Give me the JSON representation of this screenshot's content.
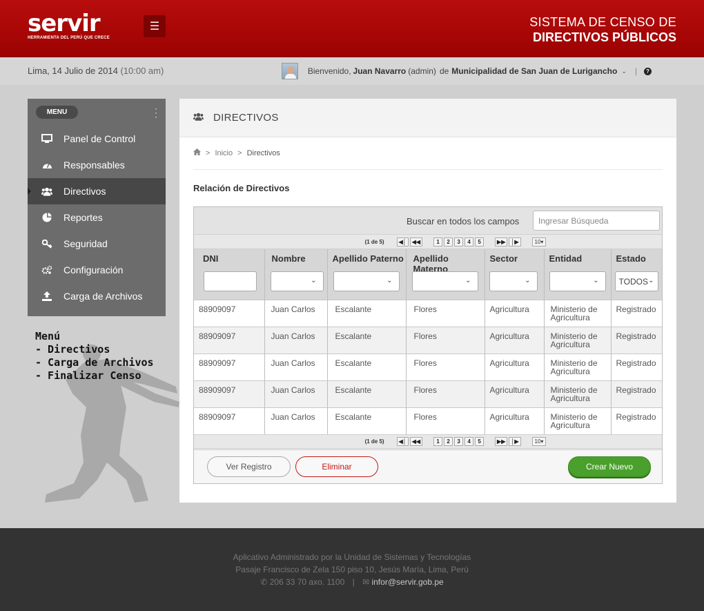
{
  "header": {
    "logo_text": "servir",
    "logo_sub": "HERRAMIENTA DEL PERÚ QUE CRECE",
    "title_line1": "SISTEMA DE CENSO  DE",
    "title_line2": "DIRECTIVOS PÚBLICOS"
  },
  "subheader": {
    "date": "Lima, 14 Julio de 2014",
    "time": "(10:00 am)",
    "welcome": "Bienvenido,",
    "user_name": "Juan Navarro",
    "role": "(admin)",
    "de": "de",
    "municipality": "Municipalidad de San Juan de Lurigancho",
    "separator": "|"
  },
  "sidebar": {
    "menu_label": "MENU",
    "items": [
      {
        "label": "Panel de Control",
        "icon": "monitor-icon",
        "active": false
      },
      {
        "label": "Responsables",
        "icon": "dashboard-icon",
        "active": false
      },
      {
        "label": "Directivos",
        "icon": "users-icon",
        "active": true
      },
      {
        "label": "Reportes",
        "icon": "pie-chart-icon",
        "active": false
      },
      {
        "label": "Seguridad",
        "icon": "key-icon",
        "active": false
      },
      {
        "label": "Configuración",
        "icon": "gears-icon",
        "active": false
      },
      {
        "label": "Carga de Archivos",
        "icon": "upload-icon",
        "active": false
      }
    ]
  },
  "menu_note": {
    "line1": "Menú",
    "line2": "- Directivos",
    "line3": "- Carga de Archivos",
    "line4": "- Finalizar Censo"
  },
  "panel": {
    "title": "DIRECTIVOS",
    "breadcrumb": {
      "home": "Inicio",
      "current": "Directivos"
    },
    "section_title": "Relación de Directivos",
    "search_label": "Buscar en todos los campos",
    "search_placeholder": "Ingresar Búsqueda",
    "pager": {
      "info": "(1 de 5)",
      "first": "⏮",
      "prev": "⏪",
      "pages": [
        "1",
        "2",
        "3",
        "4",
        "5"
      ],
      "next": "⏩",
      "last": "⏭",
      "per_page": "10▾"
    },
    "columns": [
      "DNI",
      "Nombre",
      "Apellido Paterno",
      "Apellido Materno",
      "Sector",
      "Entidad",
      "Estado"
    ],
    "estado_filter": "TODOS",
    "rows": [
      {
        "dni": "88909097",
        "nombre": "Juan Carlos",
        "paterno": "Escalante",
        "materno": "Flores",
        "sector": "Agricultura",
        "entidad": "Ministerio de Agricultura",
        "estado": "Registrado"
      },
      {
        "dni": "88909097",
        "nombre": "Juan Carlos",
        "paterno": "Escalante",
        "materno": "Flores",
        "sector": "Agricultura",
        "entidad": "Ministerio de Agricultura",
        "estado": "Registrado"
      },
      {
        "dni": "88909097",
        "nombre": "Juan Carlos",
        "paterno": "Escalante",
        "materno": "Flores",
        "sector": "Agricultura",
        "entidad": "Ministerio de Agricultura",
        "estado": "Registrado"
      },
      {
        "dni": "88909097",
        "nombre": "Juan Carlos",
        "paterno": "Escalante",
        "materno": "Flores",
        "sector": "Agricultura",
        "entidad": "Ministerio de Agricultura",
        "estado": "Registrado"
      },
      {
        "dni": "88909097",
        "nombre": "Juan Carlos",
        "paterno": "Escalante",
        "materno": "Flores",
        "sector": "Agricultura",
        "entidad": "Ministerio de Agricultura",
        "estado": "Registrado"
      }
    ],
    "buttons": {
      "ver": "Ver Registro",
      "eliminar": "Eliminar",
      "crear": "Crear Nuevo"
    }
  },
  "footer": {
    "line1": "Aplicativo Administrado por la Unidad de Sistemas y Tecnologías",
    "line2": "Pasaje Francisco de Zela 150 piso 10, Jesús María, Lima, Perú",
    "phone": "206 33 70 axo. 1100",
    "email": "infor@servir.gob.pe"
  },
  "colors": {
    "brand_red": "#b80d0d",
    "sidebar": "#6c6c6c",
    "create_green": "#4aa02c"
  }
}
